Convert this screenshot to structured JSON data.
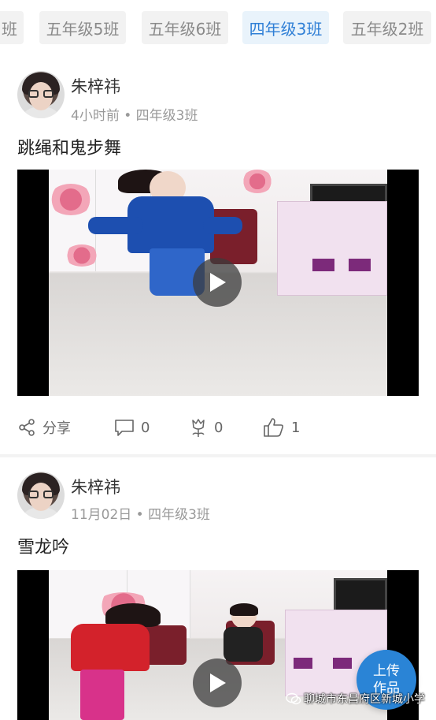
{
  "tabs": [
    {
      "label": "班",
      "active": false
    },
    {
      "label": "五年级5班",
      "active": false
    },
    {
      "label": "五年级6班",
      "active": false
    },
    {
      "label": "四年级3班",
      "active": true
    },
    {
      "label": "五年级2班",
      "active": false
    }
  ],
  "posts": [
    {
      "author": "朱梓祎",
      "meta": "4小时前 • 四年级3班",
      "title": "跳绳和鬼步舞",
      "actions": {
        "share_label": "分享",
        "comments": "0",
        "flowers": "0",
        "likes": "1"
      }
    },
    {
      "author": "朱梓祎",
      "meta": "11月02日 • 四年级3班",
      "title": "雪龙吟"
    }
  ],
  "upload_button": {
    "line1": "上传",
    "line2": "作品"
  },
  "watermark": "聊城市东昌府区新城小学",
  "colors": {
    "accent": "#2f7fd6",
    "tab_bg": "#f2f2f2",
    "active_tab_bg": "#e9f3fb",
    "upload_bg": "#2a84d6"
  }
}
